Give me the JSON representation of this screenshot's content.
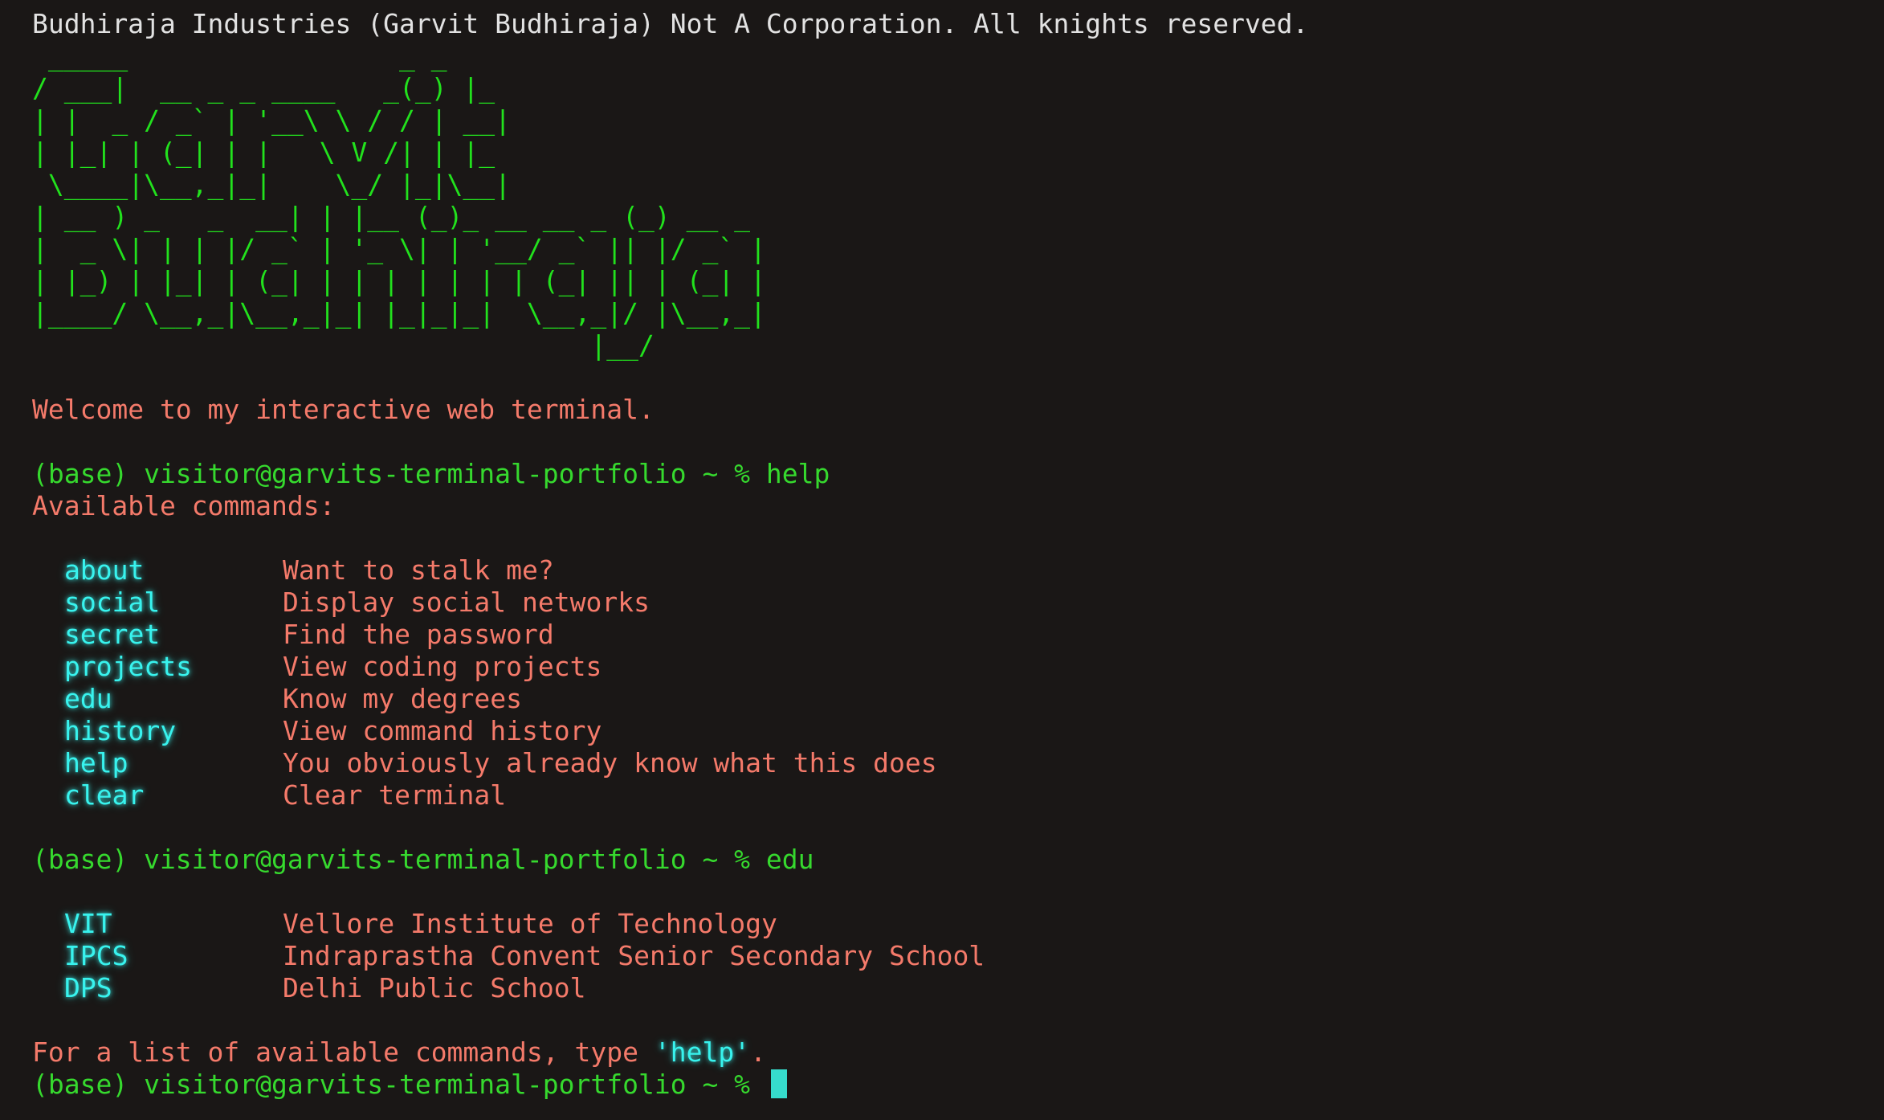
{
  "header": {
    "copyright": "Budhiraja Industries (Garvit Budhiraja) Not A Corporation. All knights reserved."
  },
  "banner": {
    "ascii_art": " _____                 _ _   \n/ ___|  __ _ _ ____   _(_) |_ \n| |  _ / _` | '__\\ \\ / / | __|\n| |_| | (_| | |   \\ V /| | |_ \n \\____|\\__,_|_|    \\_/ |_|\\__|\n| __ ) _   _  __| | |__ (_)_ __ __ _ (_) __ _ \n|  _ \\| | | |/ _` | '_ \\| | '__/ _` || |/ _` |\n| |_) | |_| | (_| | | | | | | | (_| || | (_| |\n|____/ \\__,_|\\__,_|_| |_|_|_|  \\__,_|/ |\\__,_|\n                                   |__/       "
  },
  "welcome": "Welcome to my interactive web terminal.",
  "prompt": "(base) visitor@garvits-terminal-portfolio ~ %",
  "history": {
    "first_command": "help",
    "available_heading": "Available commands:",
    "commands": [
      {
        "name": "about",
        "description": "Want to stalk me?"
      },
      {
        "name": "social",
        "description": "Display social networks"
      },
      {
        "name": "secret",
        "description": "Find the password"
      },
      {
        "name": "projects",
        "description": "View coding projects"
      },
      {
        "name": "edu",
        "description": "Know my degrees"
      },
      {
        "name": "history",
        "description": "View command history"
      },
      {
        "name": "help",
        "description": "You obviously already know what this does"
      },
      {
        "name": "clear",
        "description": "Clear terminal"
      }
    ],
    "second_command": "edu",
    "education": [
      {
        "abbr": "VIT",
        "name": "Vellore Institute of Technology"
      },
      {
        "abbr": "IPCS",
        "name": "Indraprastha Convent Senior Secondary School"
      },
      {
        "abbr": "DPS",
        "name": "Delhi Public School"
      }
    ]
  },
  "hint": {
    "before": "For a list of available commands, type ",
    "keyword": "'help'",
    "after": "."
  },
  "input": {
    "value": ""
  },
  "colors": {
    "background": "#1a1716",
    "ascii_green": "#22e11d",
    "prompt_green": "#36d92e",
    "text_salmon": "#f47a6a",
    "command_cyan": "#38f3ee",
    "cursor": "#36dccc"
  }
}
